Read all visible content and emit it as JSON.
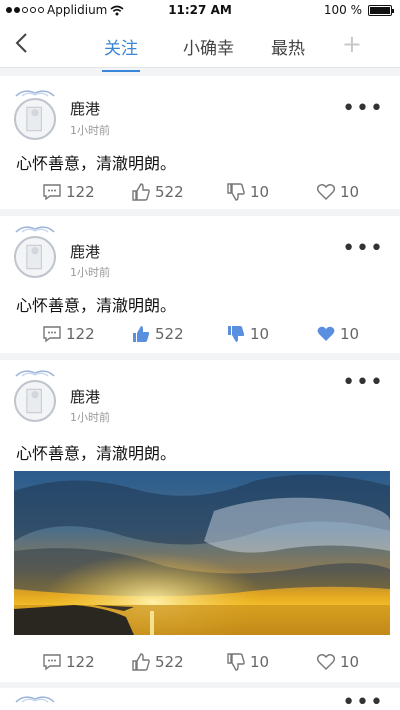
{
  "status_bar": {
    "carrier": "Applidium",
    "time": "11:27 AM",
    "battery": "100 %",
    "battery_level": 1.0
  },
  "nav": {
    "tabs": [
      {
        "label": "关注",
        "active": true
      },
      {
        "label": "小确幸",
        "active": false
      },
      {
        "label": "最热",
        "active": false
      }
    ],
    "plus_label": "+"
  },
  "colors": {
    "accent": "#3a86d8",
    "liked": "#5a8fe0"
  },
  "posts": [
    {
      "author": "鹿港",
      "time": "1小时前",
      "text": "心怀善意，清澈明朗。",
      "comments": "122",
      "likes": "522",
      "dislikes": "10",
      "favorites": "10",
      "liked": false
    },
    {
      "author": "鹿港",
      "time": "1小时前",
      "text": "心怀善意，清澈明朗。",
      "comments": "122",
      "likes": "522",
      "dislikes": "10",
      "favorites": "10",
      "liked": true
    },
    {
      "author": "鹿港",
      "time": "1小时前",
      "text": "心怀善意，清澈明朗。",
      "comments": "122",
      "likes": "522",
      "dislikes": "10",
      "favorites": "10",
      "liked": false,
      "has_image": true
    }
  ],
  "more_label": "•••"
}
